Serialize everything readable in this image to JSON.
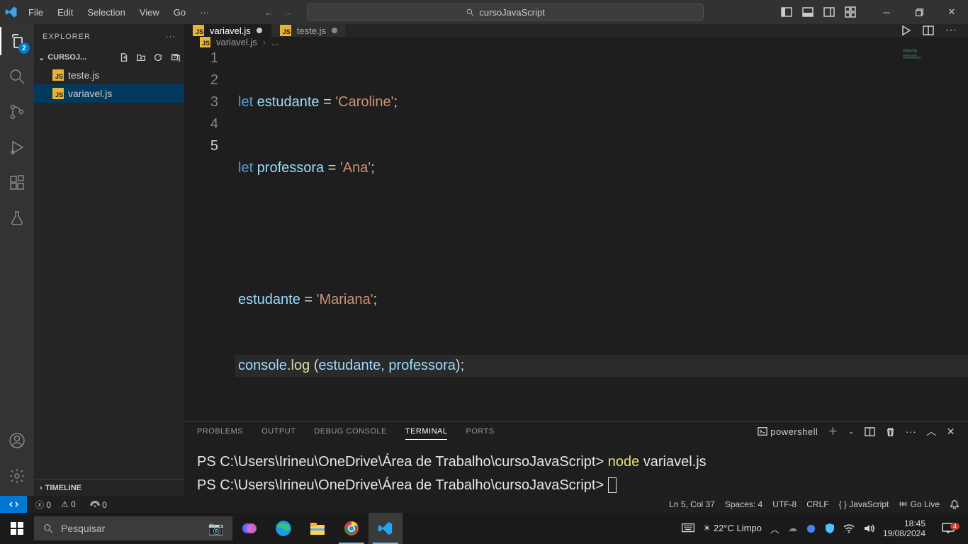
{
  "menu": {
    "file": "File",
    "edit": "Edit",
    "selection": "Selection",
    "view": "View",
    "go": "Go",
    "more": "···"
  },
  "search": {
    "text": "cursoJavaScript"
  },
  "activityBadge": "2",
  "explorer": {
    "title": "EXPLORER",
    "folder": "CURSOJ...",
    "files": [
      {
        "name": "teste.js"
      },
      {
        "name": "variavel.js"
      }
    ],
    "timeline": "TIMELINE"
  },
  "tabs": [
    {
      "name": "variavel.js",
      "dirty": true,
      "active": true
    },
    {
      "name": "teste.js",
      "dirty": true,
      "active": false
    }
  ],
  "breadcrumb": {
    "file": "variavel.js",
    "more": "..."
  },
  "code": {
    "lines": 5,
    "l1": {
      "kw": "let",
      "var": " estudante ",
      "eq": "= ",
      "str": "'Caroline'",
      "end": ";"
    },
    "l2": {
      "kw": "let",
      "var": " professora ",
      "eq": "= ",
      "str": "'Ana'",
      "end": ";"
    },
    "l4": {
      "var": "estudante ",
      "eq": "= ",
      "str": "'Mariana'",
      "end": ";"
    },
    "l5": {
      "obj": "console",
      "dot": ".",
      "fn": "log",
      "open": " (",
      "a1": "estudante",
      "comma": ", ",
      "a2": "professora",
      "close": ");"
    }
  },
  "panel": {
    "tabs": {
      "problems": "PROBLEMS",
      "output": "OUTPUT",
      "debug": "DEBUG CONSOLE",
      "terminal": "TERMINAL",
      "ports": "PORTS"
    },
    "shell": "powershell"
  },
  "terminal": {
    "prompt1": "PS C:\\Users\\Irineu\\OneDrive\\Área de Trabalho\\cursoJavaScript> ",
    "node": "node",
    "arg": " variavel.js",
    "prompt2": "PS C:\\Users\\Irineu\\OneDrive\\Área de Trabalho\\cursoJavaScript> "
  },
  "status": {
    "errors": "0",
    "warnings": "0",
    "ports": "0",
    "lncol": "Ln 5, Col 37",
    "spaces": "Spaces: 4",
    "enc": "UTF-8",
    "eol": "CRLF",
    "lang": "JavaScript",
    "golive": "Go Live"
  },
  "taskbar": {
    "searchPlaceholder": "Pesquisar",
    "weather": "22°C  Limpo",
    "time": "18:45",
    "date": "19/08/2024",
    "notifCount": "4"
  }
}
